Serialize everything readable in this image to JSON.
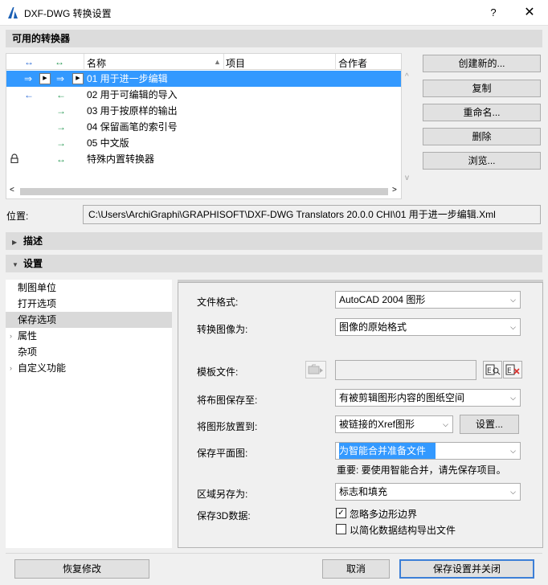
{
  "window": {
    "title": "DXF-DWG 转换设置",
    "help": "?",
    "close": "✕"
  },
  "converters": {
    "header": "可用的转换器",
    "columns": {
      "name": "名称",
      "project": "项目",
      "author": "合作者"
    },
    "rows": [
      {
        "name": "01 用于进一步编辑",
        "selected": true
      },
      {
        "name": "02 用于可编辑的导入"
      },
      {
        "name": "03 用于按原样的输出"
      },
      {
        "name": "04 保留画笔的索引号"
      },
      {
        "name": "05 中文版"
      },
      {
        "name": "特殊内置转换器"
      }
    ],
    "buttons": {
      "create": "创建新的...",
      "copy": "复制",
      "rename": "重命名...",
      "delete": "删除",
      "browse": "浏览..."
    }
  },
  "location": {
    "label": "位置:",
    "path": "C:\\Users\\ArchiGraphi\\GRAPHISOFT\\DXF-DWG Translators 20.0.0 CHI\\01 用于进一步编辑.Xml"
  },
  "description_header": "描述",
  "settings_header": "设置",
  "nav": [
    {
      "label": "制图单位"
    },
    {
      "label": "打开选项"
    },
    {
      "label": "保存选项",
      "selected": true
    },
    {
      "label": "属性",
      "expandable": true
    },
    {
      "label": "杂项"
    },
    {
      "label": "自定义功能",
      "expandable": true
    }
  ],
  "form": {
    "file_format": {
      "label": "文件格式:",
      "value": "AutoCAD 2004 图形"
    },
    "convert_images": {
      "label": "转换图像为:",
      "value": "图像的原始格式"
    },
    "template": {
      "label": "模板文件:",
      "value": ""
    },
    "layout_save": {
      "label": "将布图保存至:",
      "value": "有被剪辑图形内容的图纸空间"
    },
    "drawing_place": {
      "label": "将图形放置到:",
      "value": "被链接的Xref图形",
      "settings_button": "设置..."
    },
    "floor_plan": {
      "label": "保存平面图:",
      "value": "为智能合并准备文件",
      "note": "重要: 要使用智能合并，请先保存项目。"
    },
    "zone": {
      "label": "区域另存为:",
      "value": "标志和填充"
    },
    "save3d": {
      "label": "保存3D数据:",
      "opt1": {
        "label": "忽略多边形边界",
        "checked": true
      },
      "opt2": {
        "label": "以简化数据结构导出文件",
        "checked": false
      }
    }
  },
  "footer": {
    "revert": "恢复修改",
    "cancel": "取消",
    "save_close": "保存设置并关闭"
  },
  "colors": {
    "selection": "#3399ff",
    "export_arrow": "#2a9a55",
    "import_arrow": "#2a6ad6",
    "accent_border": "#3c7fd7"
  }
}
